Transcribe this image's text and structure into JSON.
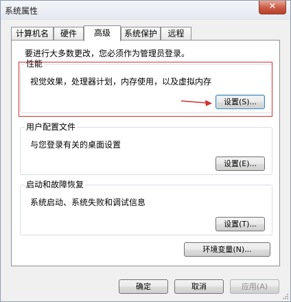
{
  "window": {
    "title": "系统属性",
    "close_glyph": "✕"
  },
  "tabs": [
    {
      "label": "计算机名",
      "active": false
    },
    {
      "label": "硬件",
      "active": false
    },
    {
      "label": "高级",
      "active": true
    },
    {
      "label": "系统保护",
      "active": false
    },
    {
      "label": "远程",
      "active": false
    }
  ],
  "advanced": {
    "admin_note": "要进行大多数更改，您必须作为管理员登录。",
    "performance": {
      "title": "性能",
      "description": "视觉效果，处理器计划，内存使用，以及虚拟内存",
      "button": "设置(S)..."
    },
    "user_profiles": {
      "title": "用户配置文件",
      "description": "与您登录有关的桌面设置",
      "button": "设置(E)..."
    },
    "startup_recovery": {
      "title": "启动和故障恢复",
      "description": "系统启动、系统失败和调试信息",
      "button": "设置(T)..."
    },
    "env_button": "环境变量(N)..."
  },
  "footer": {
    "ok": "确定",
    "cancel": "取消",
    "apply": "应用(A)"
  },
  "annotation": {
    "highlight_color": "#d03030"
  }
}
